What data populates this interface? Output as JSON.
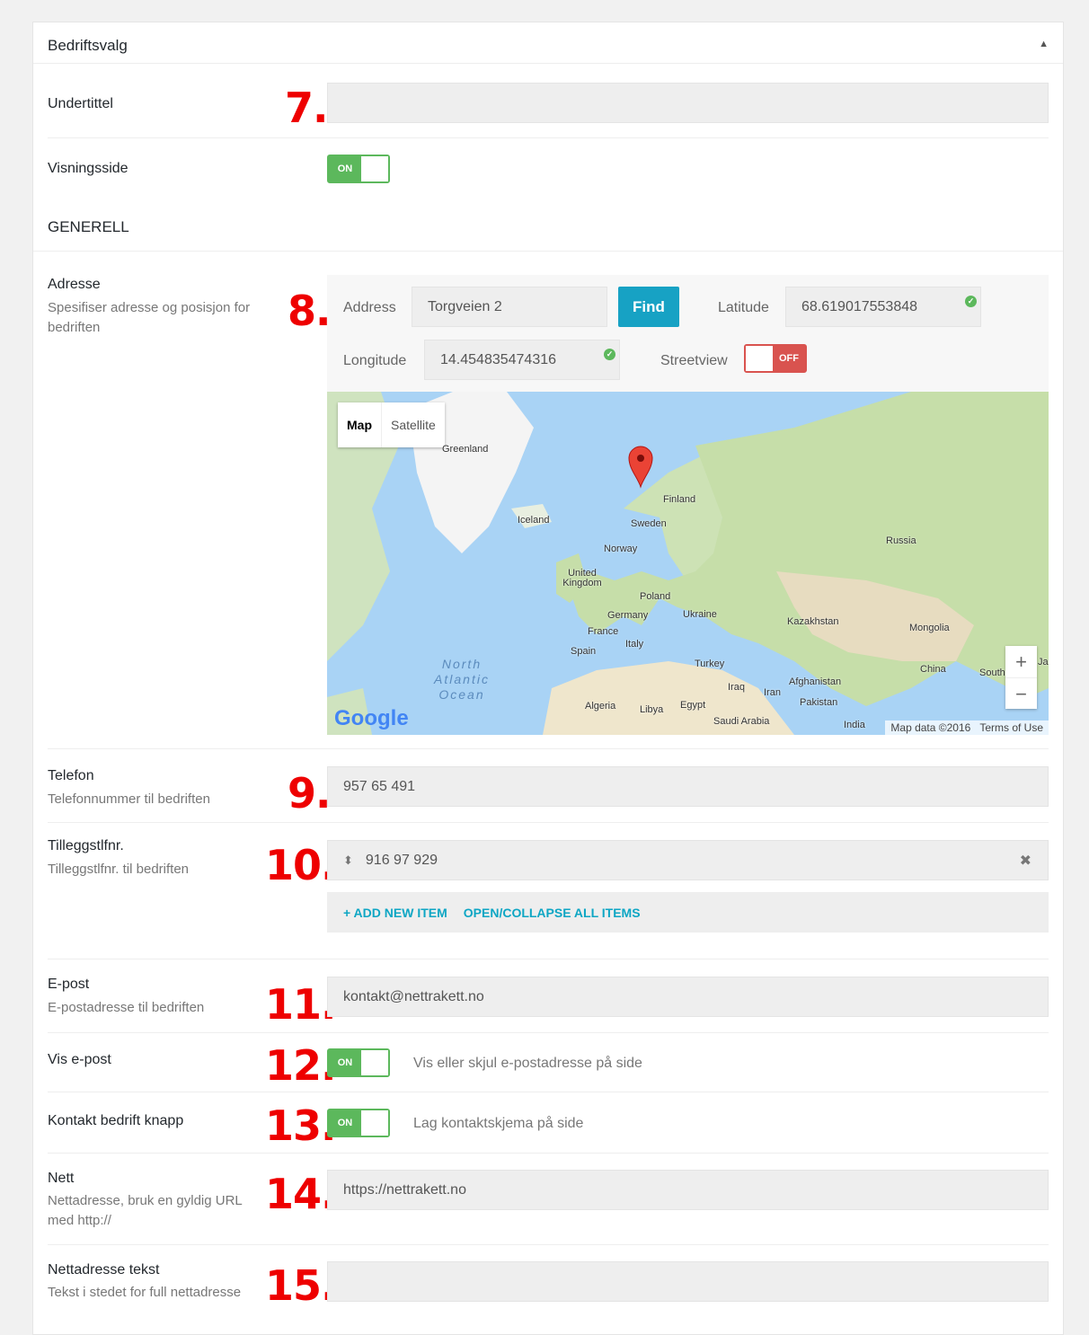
{
  "panel": {
    "title": "Bedriftsvalg"
  },
  "fields": {
    "undertittel": {
      "label": "Undertittel",
      "marker": "7.",
      "value": ""
    },
    "visningsside": {
      "label": "Visningsside",
      "toggle": "ON"
    },
    "generell_heading": "GENERELL",
    "adresse": {
      "label": "Adresse",
      "desc": "Spesifiser adresse og posisjon for bedriften",
      "marker": "8.",
      "address_label": "Address",
      "address_value": "Torgveien 2",
      "find_label": "Find",
      "latitude_label": "Latitude",
      "latitude_value": "68.619017553848",
      "longitude_label": "Longitude",
      "longitude_value": "14.454835474316",
      "streetview_label": "Streetview",
      "streetview_toggle": "OFF"
    },
    "map": {
      "tab_map": "Map",
      "tab_satellite": "Satellite",
      "zoom_in": "+",
      "zoom_out": "−",
      "logo": "Google",
      "attribution": "Map data ©2016",
      "terms": "Terms of Use",
      "ocean": "North Atlantic Ocean",
      "places": [
        {
          "name": "Greenland"
        },
        {
          "name": "Iceland"
        },
        {
          "name": "Finland"
        },
        {
          "name": "Sweden"
        },
        {
          "name": "Norway"
        },
        {
          "name": "Russia"
        },
        {
          "name": "United Kingdom"
        },
        {
          "name": "Poland"
        },
        {
          "name": "Germany"
        },
        {
          "name": "Ukraine"
        },
        {
          "name": "France"
        },
        {
          "name": "Italy"
        },
        {
          "name": "Spain"
        },
        {
          "name": "Kazakhstan"
        },
        {
          "name": "Mongolia"
        },
        {
          "name": "Turkey"
        },
        {
          "name": "China"
        },
        {
          "name": "South"
        },
        {
          "name": "Ja"
        },
        {
          "name": "Afghanistan"
        },
        {
          "name": "Iraq"
        },
        {
          "name": "Iran"
        },
        {
          "name": "Pakistan"
        },
        {
          "name": "Algeria"
        },
        {
          "name": "Libya"
        },
        {
          "name": "Egypt"
        },
        {
          "name": "Saudi Arabia"
        },
        {
          "name": "India"
        }
      ]
    },
    "telefon": {
      "label": "Telefon",
      "desc": "Telefonnummer til bedriften",
      "marker": "9.",
      "value": "957 65 491"
    },
    "tillegg": {
      "label": "Tilleggstlfnr.",
      "desc": "Tilleggstlfnr. til bedriften",
      "marker": "10.",
      "item_value": "916 97 929",
      "add_label": "+ ADD NEW ITEM",
      "collapse_label": "OPEN/COLLAPSE ALL ITEMS"
    },
    "epost": {
      "label": "E-post",
      "desc": "E-postadresse til bedriften",
      "marker": "11.",
      "value": "kontakt@nettrakett.no"
    },
    "vis_epost": {
      "label": "Vis e-post",
      "marker": "12.",
      "toggle": "ON",
      "help": "Vis eller skjul e-postadresse på side"
    },
    "kontakt": {
      "label": "Kontakt bedrift knapp",
      "marker": "13.",
      "toggle": "ON",
      "help": "Lag kontaktskjema på side"
    },
    "nett": {
      "label": "Nett",
      "desc": "Nettadresse, bruk en gyldig URL med http://",
      "marker": "14.",
      "value": "https://nettrakett.no"
    },
    "nettadresse_tekst": {
      "label": "Nettadresse tekst",
      "desc": "Tekst i stedet for full nettadresse",
      "marker": "15.",
      "value": ""
    }
  },
  "colors": {
    "toggle_on": "#5cb85c",
    "toggle_off": "#d9534f",
    "find_button": "#17a2c4",
    "link": "#0ea6c4",
    "marker": "#e00000"
  }
}
